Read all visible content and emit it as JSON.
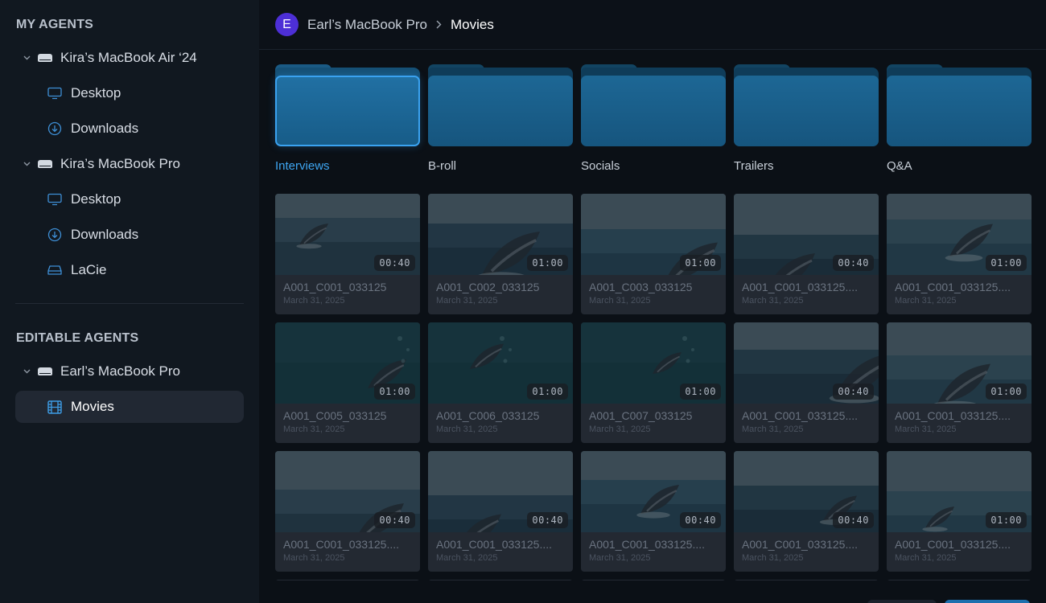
{
  "sidebar": {
    "my_agents_title": "MY AGENTS",
    "editable_agents_title": "EDITABLE AGENTS",
    "my_agents": [
      {
        "label": "Kira’s MacBook Air ‘24",
        "children": [
          {
            "label": "Desktop",
            "icon": "monitor-icon"
          },
          {
            "label": "Downloads",
            "icon": "download-icon"
          }
        ]
      },
      {
        "label": "Kira’s MacBook Pro",
        "children": [
          {
            "label": "Desktop",
            "icon": "monitor-icon"
          },
          {
            "label": "Downloads",
            "icon": "download-icon"
          },
          {
            "label": "LaCie",
            "icon": "external-drive-icon"
          }
        ]
      }
    ],
    "editable_agents": [
      {
        "label": "Earl’s MacBook Pro",
        "children": [
          {
            "label": "Movies",
            "icon": "film-icon",
            "selected": true
          }
        ]
      }
    ]
  },
  "header": {
    "avatar_letter": "E",
    "breadcrumb_root": "Earl’s MacBook Pro",
    "breadcrumb_current": "Movies"
  },
  "folders": [
    {
      "label": "Interviews",
      "selected": true
    },
    {
      "label": "B-roll"
    },
    {
      "label": "Socials"
    },
    {
      "label": "Trailers"
    },
    {
      "label": "Q&A"
    }
  ],
  "clips": [
    {
      "name": "A001_C001_033125",
      "date": "March 31, 2025",
      "duration": "00:40"
    },
    {
      "name": "A001_C002_033125",
      "date": "March 31, 2025",
      "duration": "01:00"
    },
    {
      "name": "A001_C003_033125",
      "date": "March 31, 2025",
      "duration": "01:00"
    },
    {
      "name": "A001_C001_033125....",
      "date": "March 31, 2025",
      "duration": "00:40"
    },
    {
      "name": "A001_C001_033125....",
      "date": "March 31, 2025",
      "duration": "01:00"
    },
    {
      "name": "A001_C005_033125",
      "date": "March 31, 2025",
      "duration": "01:00"
    },
    {
      "name": "A001_C006_033125",
      "date": "March 31, 2025",
      "duration": "01:00"
    },
    {
      "name": "A001_C007_033125",
      "date": "March 31, 2025",
      "duration": "01:00"
    },
    {
      "name": "A001_C001_033125....",
      "date": "March 31, 2025",
      "duration": "00:40"
    },
    {
      "name": "A001_C001_033125....",
      "date": "March 31, 2025",
      "duration": "01:00"
    },
    {
      "name": "A001_C001_033125....",
      "date": "March 31, 2025",
      "duration": "00:40"
    },
    {
      "name": "A001_C001_033125....",
      "date": "March 31, 2025",
      "duration": "00:40"
    },
    {
      "name": "A001_C001_033125....",
      "date": "March 31, 2025",
      "duration": "00:40"
    },
    {
      "name": "A001_C001_033125....",
      "date": "March 31, 2025",
      "duration": "00:40"
    },
    {
      "name": "A001_C001_033125....",
      "date": "March 31, 2025",
      "duration": "01:00"
    }
  ],
  "colors": {
    "accent": "#3ea6f2",
    "avatar": "#4d2fd6",
    "folder": "#1d6795"
  }
}
